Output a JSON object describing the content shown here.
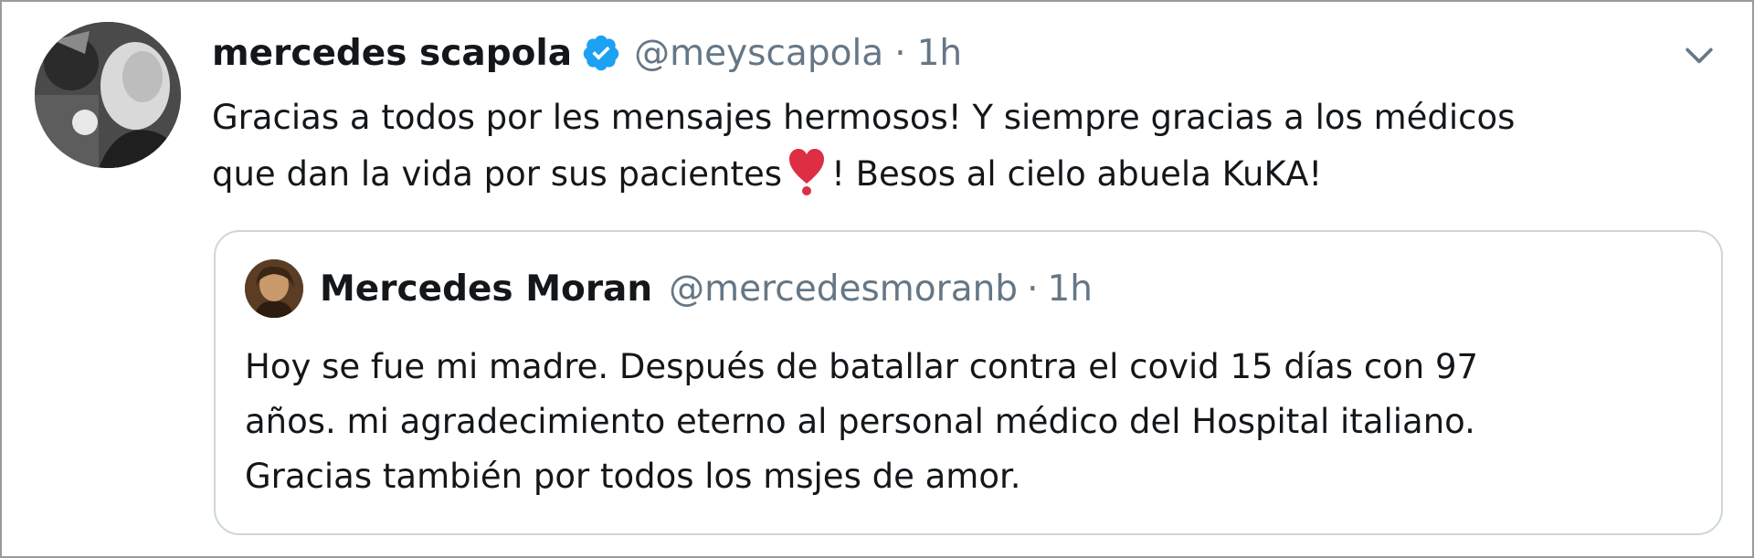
{
  "tweet": {
    "author_name": "mercedes scapola",
    "handle": "@meyscapola",
    "separator": "·",
    "time": "1h",
    "text_lines": [
      "Gracias a todos por les mensajes hermosos! Y siempre gracias  a los médicos",
      "que dan la vida por sus pacientes",
      "! Besos al cielo abuela KuKA!"
    ],
    "emoji": "heavy-exclamation-heart",
    "verified_color": "#1da1f2"
  },
  "quoted_tweet": {
    "author_name": "Mercedes Moran",
    "handle": "@mercedesmoranb",
    "separator": "·",
    "time": "1h",
    "text_lines": [
      "Hoy se fue mi madre. Después de batallar contra el covid 15 días con 97",
      "años. mi agradecimiento eterno al personal médico del Hospital italiano.",
      "Gracias también por todos los msjes de amor."
    ]
  },
  "icons": {
    "verified": "verified-badge-icon",
    "menu": "chevron-down-icon"
  },
  "colors": {
    "text_primary": "#14171a",
    "text_secondary": "#657786",
    "border": "#ccd6dd",
    "heart": "#dd2e44"
  }
}
